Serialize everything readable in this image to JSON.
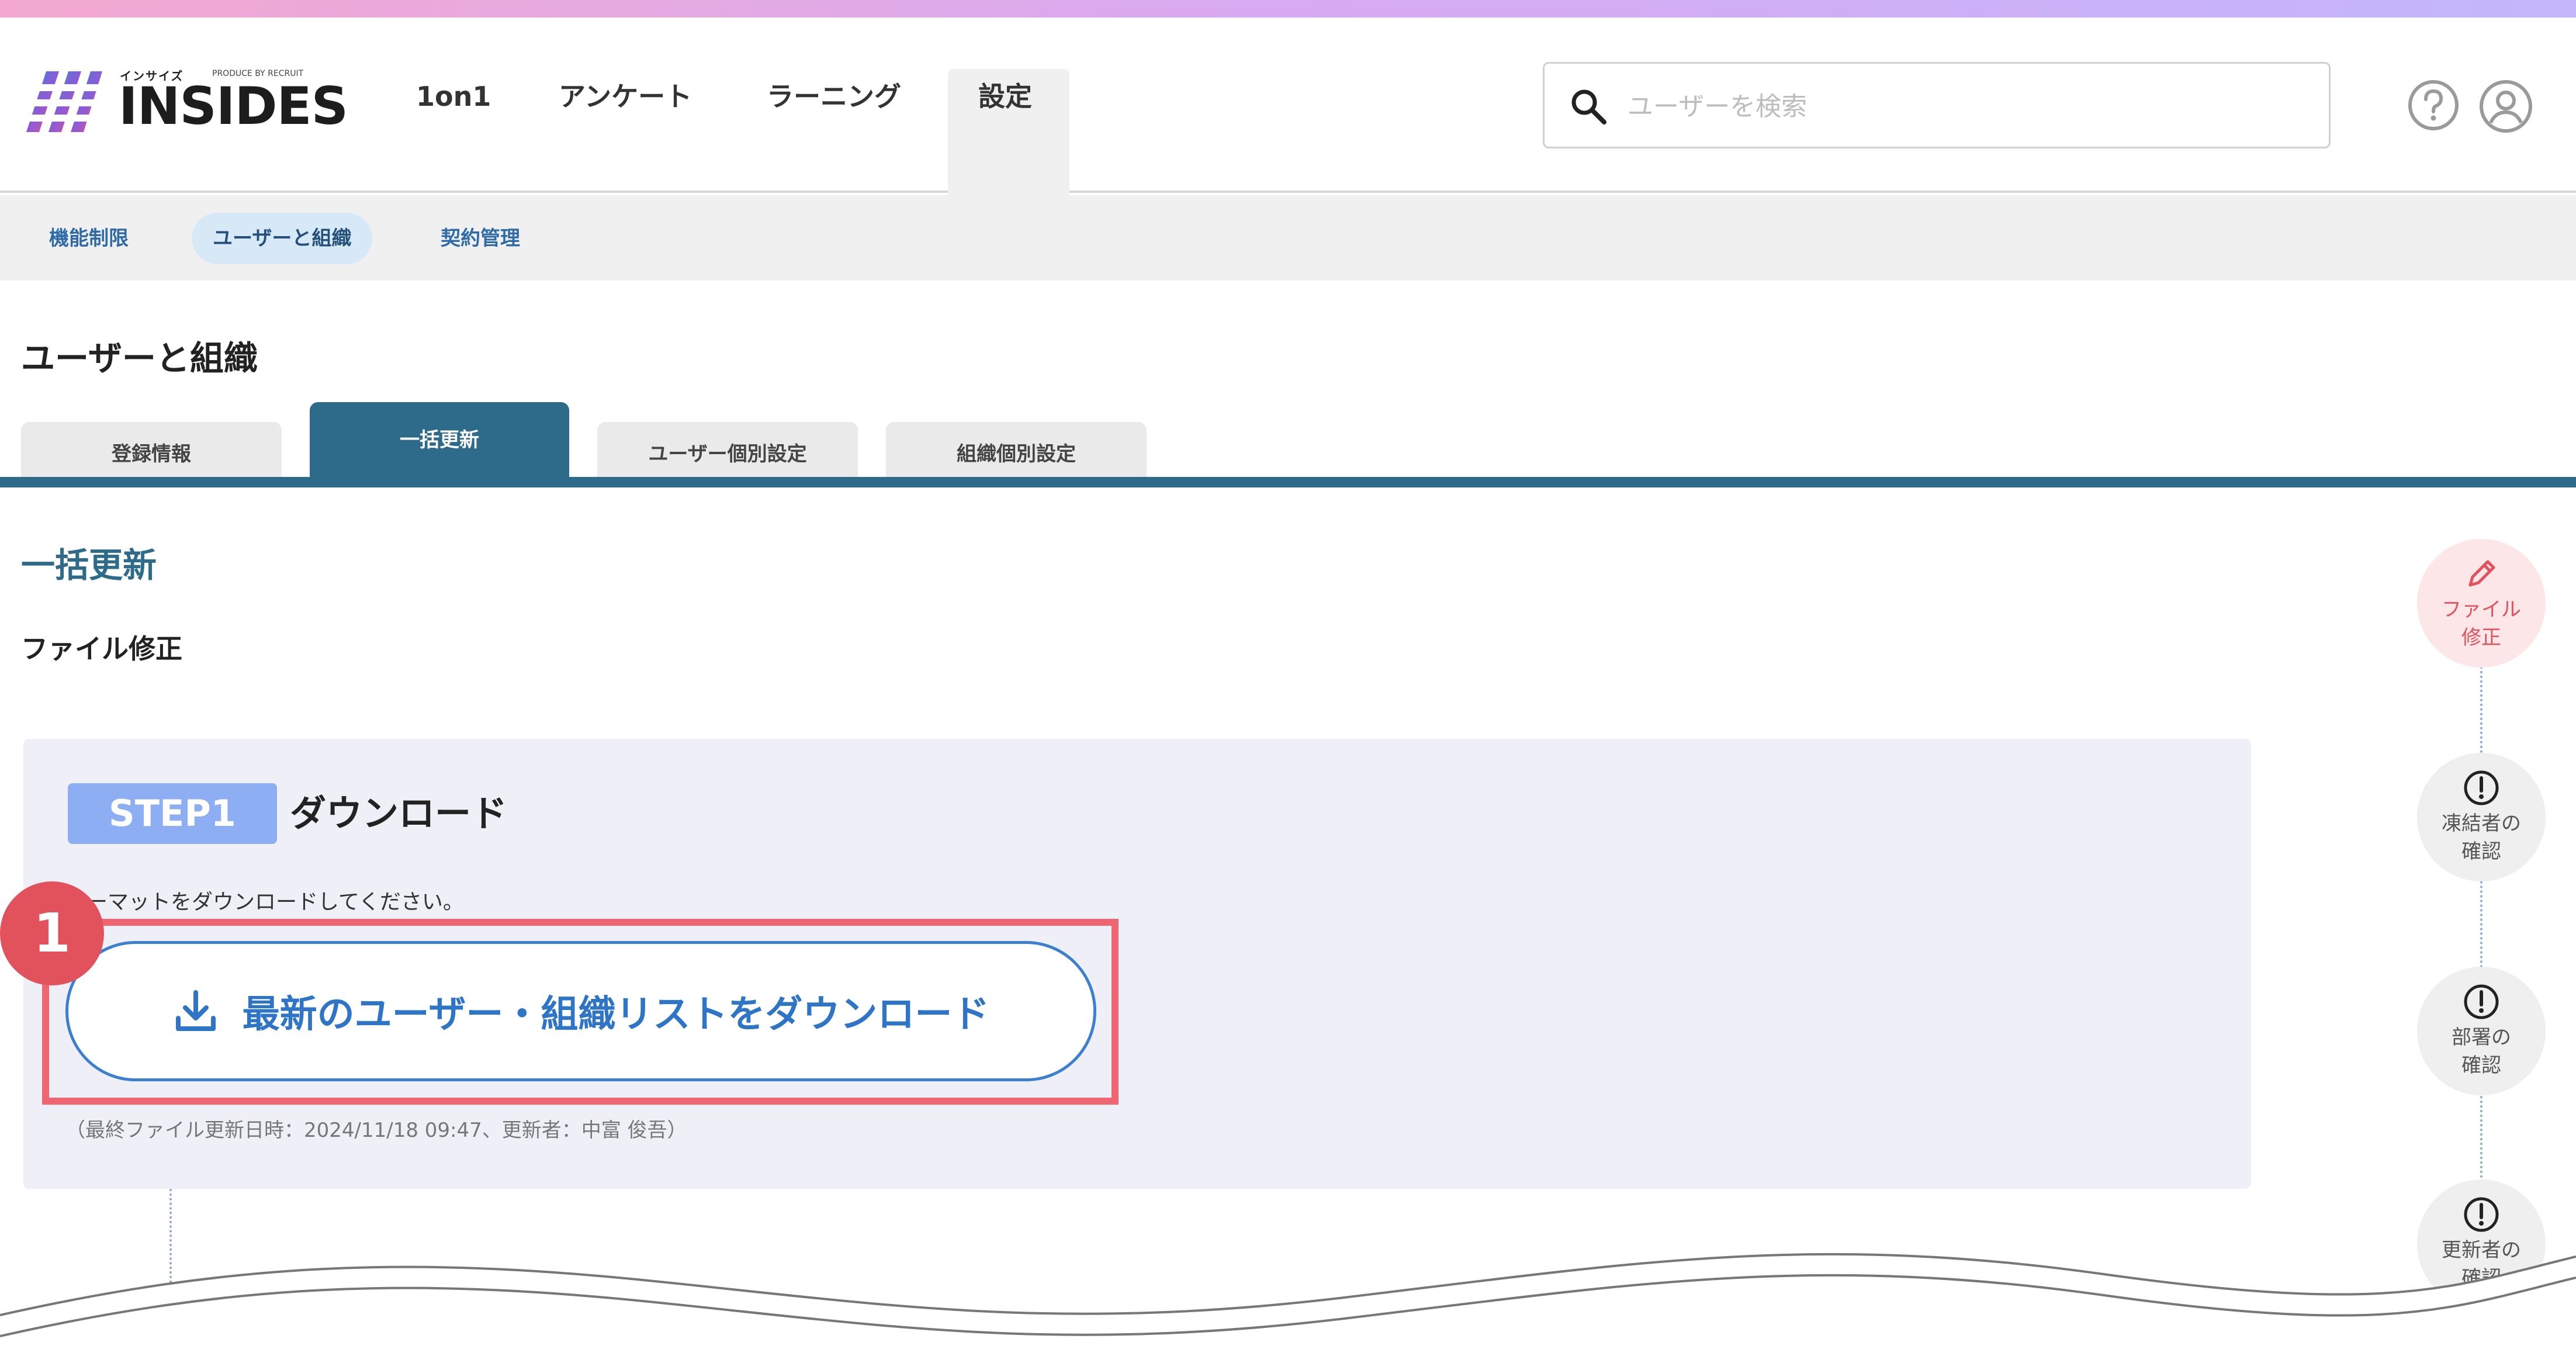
{
  "header": {
    "logo_ruby": "インサイズ",
    "logo_produce": "PRODUCE BY RECRUIT",
    "logo_text": "INSIDES",
    "nav": [
      "1on1",
      "アンケート",
      "ラーニング",
      "設定"
    ],
    "active_nav": "設定",
    "search_placeholder": "ユーザーを検索",
    "icons": [
      "help-icon",
      "user-icon"
    ]
  },
  "subnav": {
    "items": [
      "機能制限",
      "ユーザーと組織",
      "契約管理"
    ],
    "active": "ユーザーと組織"
  },
  "page": {
    "title": "ユーザーと組織",
    "tabs": [
      "登録情報",
      "一括更新",
      "ユーザー個別設定",
      "組織個別設定"
    ],
    "active_tab": "一括更新",
    "section_title": "一括更新",
    "subsection_title": "ファイル修正"
  },
  "step1": {
    "badge": "STEP1",
    "title": "ダウンロード",
    "description": "ォーマットをダウンロードしてください。",
    "button_label": "最新のユーザー・組織リストをダウンロード",
    "last_updated": "（最終ファイル更新日時：2024/11/18 09:47、更新者：中富 俊吾）"
  },
  "annotation": {
    "marker_number": "1"
  },
  "stepper": {
    "items": [
      {
        "label": "ファイル修正",
        "line1": "ファイル",
        "line2": "修正",
        "icon": "pencil-icon",
        "active": true
      },
      {
        "label": "凍結者の確認",
        "line1": "凍結者の",
        "line2": "確認",
        "icon": "alert-icon",
        "active": false
      },
      {
        "label": "部署の確認",
        "line1": "部署の",
        "line2": "確認",
        "icon": "alert-icon",
        "active": false
      },
      {
        "label": "更新者の確認",
        "line1": "更新者の",
        "line2": "確認",
        "icon": "alert-icon",
        "active": false
      }
    ]
  },
  "colors": {
    "accent": "#2e6b8a",
    "link": "#2d6aa6",
    "highlight": "#ef6673",
    "step_badge": "#8eaef3",
    "card_bg": "#eff0f7"
  }
}
